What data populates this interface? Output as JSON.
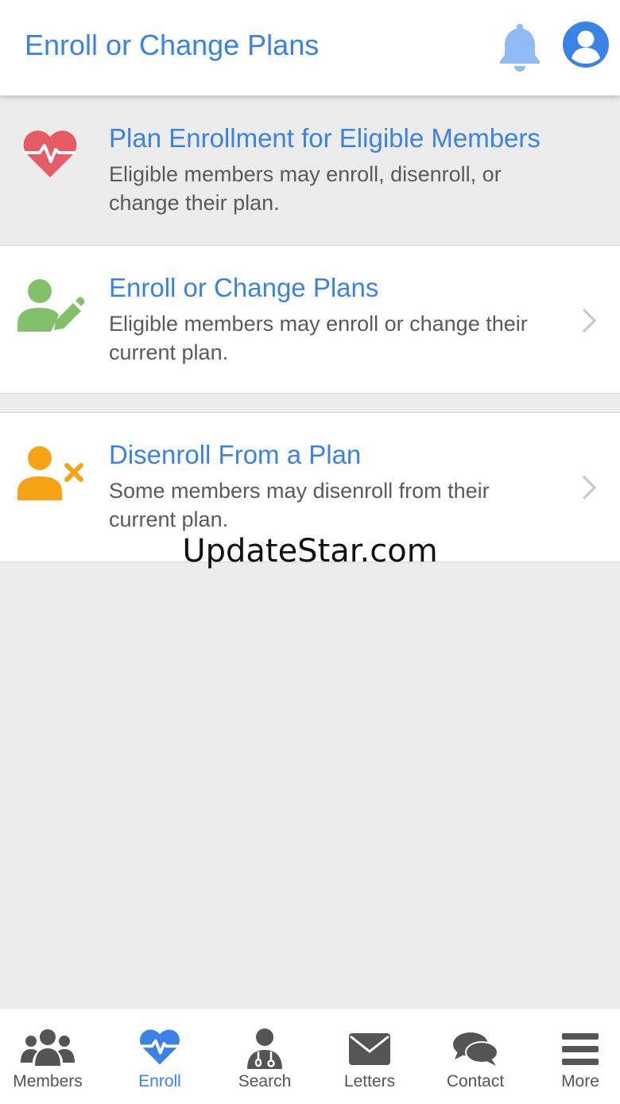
{
  "header": {
    "title": "Enroll or Change Plans",
    "bell_icon": "bell-icon",
    "account_icon": "user-circle-icon"
  },
  "items": [
    {
      "title": "Plan Enrollment for Eligible Members",
      "description": "Eligible members may enroll, disenroll, or change their plan.",
      "icon": "heart-pulse-icon",
      "icon_color": "#e65c64",
      "has_chevron": false
    },
    {
      "title": "Enroll or Change Plans",
      "description": "Eligible members may enroll or change their current plan.",
      "icon": "user-edit-icon",
      "icon_color": "#82c16a",
      "has_chevron": true
    },
    {
      "title": "Disenroll From a Plan",
      "description": "Some members may disenroll from their current plan.",
      "icon": "user-remove-icon",
      "icon_color": "#f6a416",
      "has_chevron": true
    }
  ],
  "watermark": "UpdateStar.com",
  "bottom_nav": [
    {
      "label": "Members",
      "icon": "users-icon",
      "active": false
    },
    {
      "label": "Enroll",
      "icon": "heart-pulse-icon",
      "active": true
    },
    {
      "label": "Search",
      "icon": "doctor-icon",
      "active": false
    },
    {
      "label": "Letters",
      "icon": "envelope-icon",
      "active": false
    },
    {
      "label": "Contact",
      "icon": "chat-bubbles-icon",
      "active": false
    },
    {
      "label": "More",
      "icon": "menu-icon",
      "active": false
    }
  ],
  "colors": {
    "accent": "#3b82e6",
    "bell": "#8fbaf5",
    "nav_icon": "#555555",
    "background": "#ececec"
  }
}
